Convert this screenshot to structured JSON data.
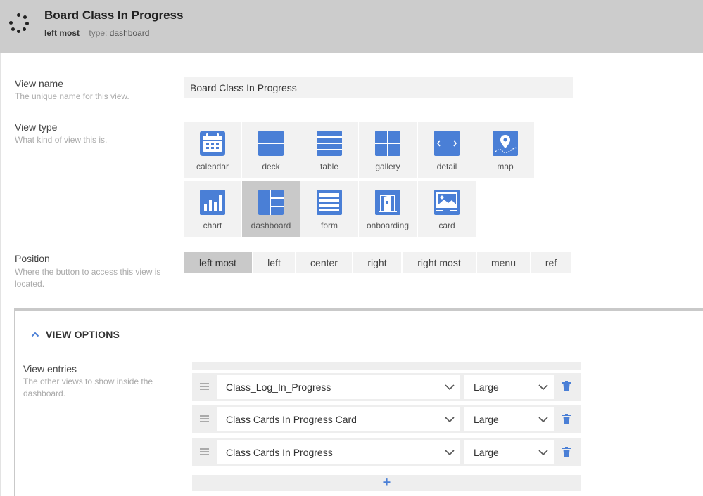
{
  "header": {
    "title": "Board Class In Progress",
    "position": "left most",
    "type_label": "type:",
    "type_value": "dashboard"
  },
  "view_name": {
    "label": "View name",
    "description": "The unique name for this view.",
    "value": "Board Class In Progress"
  },
  "view_type": {
    "label": "View type",
    "description": "What kind of view this is.",
    "selected": "dashboard",
    "options": [
      {
        "label": "calendar",
        "icon": "calendar-icon"
      },
      {
        "label": "deck",
        "icon": "deck-icon"
      },
      {
        "label": "table",
        "icon": "table-icon"
      },
      {
        "label": "gallery",
        "icon": "gallery-icon"
      },
      {
        "label": "detail",
        "icon": "detail-icon"
      },
      {
        "label": "map",
        "icon": "map-icon"
      },
      {
        "label": "chart",
        "icon": "chart-icon"
      },
      {
        "label": "dashboard",
        "icon": "dashboard-icon"
      },
      {
        "label": "form",
        "icon": "form-icon"
      },
      {
        "label": "onboarding",
        "icon": "onboarding-icon"
      },
      {
        "label": "card",
        "icon": "card-icon"
      }
    ]
  },
  "position": {
    "label": "Position",
    "description": "Where the button to access this view is located.",
    "selected": "left most",
    "options": [
      "left most",
      "left",
      "center",
      "right",
      "right most",
      "menu",
      "ref"
    ]
  },
  "view_options": {
    "title": "VIEW OPTIONS",
    "entries_label": "View entries",
    "entries_description": "The other views to show inside the dashboard.",
    "entries": [
      {
        "view": "Class_Log_In_Progress",
        "size": "Large"
      },
      {
        "view": "Class Cards In Progress Card",
        "size": "Large"
      },
      {
        "view": "Class Cards In Progress",
        "size": "Large"
      }
    ],
    "add_label": "+"
  },
  "colors": {
    "accent": "#4a7fd6",
    "header_bg": "#cccccc",
    "tile_bg": "#f2f2f2",
    "tile_selected_bg": "#c9c9c9"
  }
}
